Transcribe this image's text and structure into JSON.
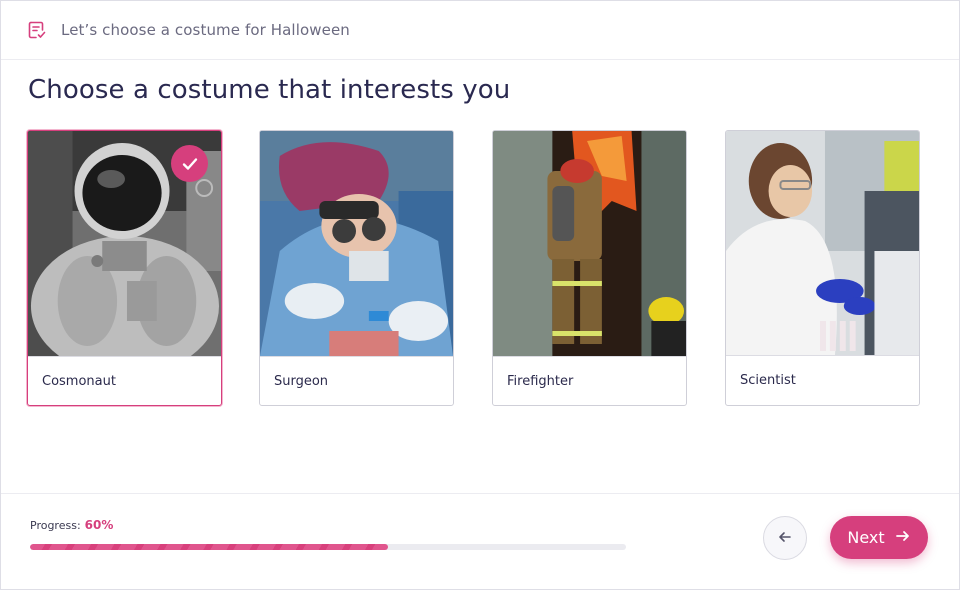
{
  "header": {
    "survey_title": "Let’s choose a costume for Halloween",
    "icon": "survey-checklist-icon"
  },
  "main": {
    "heading": "Choose a costume that interests you",
    "options": [
      {
        "label": "Cosmonaut",
        "selected": true
      },
      {
        "label": "Surgeon",
        "selected": false
      },
      {
        "label": "Firefighter",
        "selected": false
      },
      {
        "label": "Scientist",
        "selected": false
      }
    ]
  },
  "footer": {
    "progress_label": "Progress:",
    "progress_value": "60%",
    "progress_fraction": 0.6,
    "back_icon": "arrow-left-icon",
    "next_label": "Next",
    "next_icon": "arrow-right-icon"
  },
  "colors": {
    "accent": "#d63f7d",
    "text": "#2a2950",
    "muted": "#6b6a80"
  }
}
